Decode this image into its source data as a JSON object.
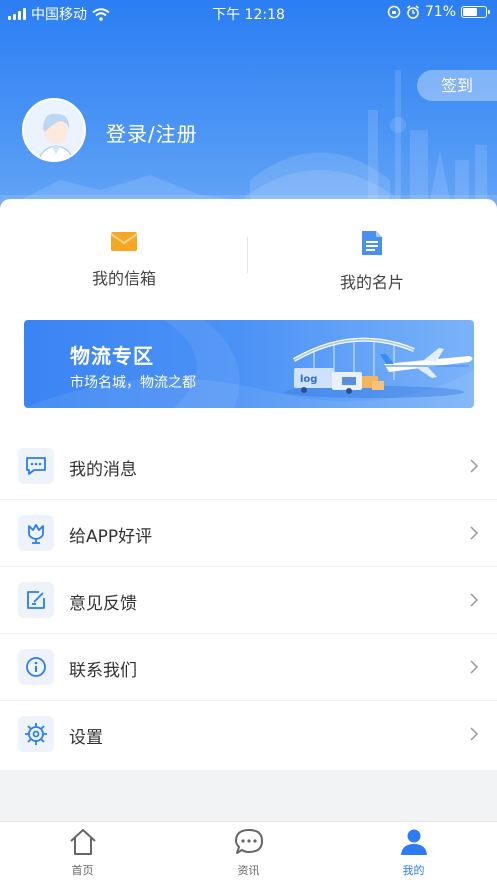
{
  "status_bar": {
    "carrier": "中国移动",
    "time": "下午 12:18",
    "battery": "71%",
    "battery_level": 0.71
  },
  "profile": {
    "signin_label": "签到",
    "login_label": "登录/注册"
  },
  "quick_links": [
    {
      "label": "我的信箱",
      "icon": "mailbox-icon"
    },
    {
      "label": "我的名片",
      "icon": "document-icon"
    }
  ],
  "banner": {
    "title": "物流专区",
    "subtitle": "市场名城，物流之都",
    "truck_text": "log"
  },
  "menu": {
    "items": [
      {
        "label": "我的消息",
        "icon": "message-icon"
      },
      {
        "label": "给APP好评",
        "icon": "thumbs-up-icon"
      },
      {
        "label": "意见反馈",
        "icon": "feedback-icon"
      },
      {
        "label": "联系我们",
        "icon": "info-icon"
      },
      {
        "label": "设置",
        "icon": "settings-icon"
      }
    ]
  },
  "tabbar": {
    "tabs": [
      {
        "label": "首页",
        "icon": "home-icon"
      },
      {
        "label": "资讯",
        "icon": "chat-icon"
      },
      {
        "label": "我的",
        "icon": "person-icon",
        "active": true
      }
    ]
  },
  "colors": {
    "accent": "#2d7cf3",
    "header_blue": "#3b87f4",
    "mail_orange": "#f5a623"
  }
}
